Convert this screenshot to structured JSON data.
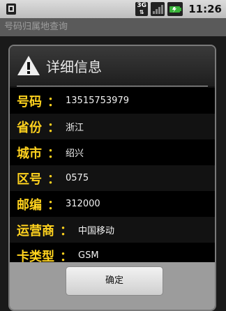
{
  "status_bar": {
    "network_label": "3G",
    "time": "11:26"
  },
  "app": {
    "title": "号码归属地查询"
  },
  "dialog": {
    "title": "详细信息",
    "rows": [
      {
        "label": "号码",
        "colon": "：",
        "value": "13515753979"
      },
      {
        "label": "省份",
        "colon": "：",
        "value": "浙江"
      },
      {
        "label": "城市",
        "colon": "：",
        "value": "绍兴"
      },
      {
        "label": "区号",
        "colon": "：",
        "value": "0575"
      },
      {
        "label": "邮编",
        "colon": "：",
        "value": "312000"
      },
      {
        "label": "运营商",
        "colon": "：",
        "value": "中国移动"
      },
      {
        "label": "卡类型",
        "colon": "：",
        "value": "GSM"
      }
    ],
    "ok_label": "确定"
  },
  "colors": {
    "label": "#ffd21e",
    "value": "#f2f2f2"
  }
}
